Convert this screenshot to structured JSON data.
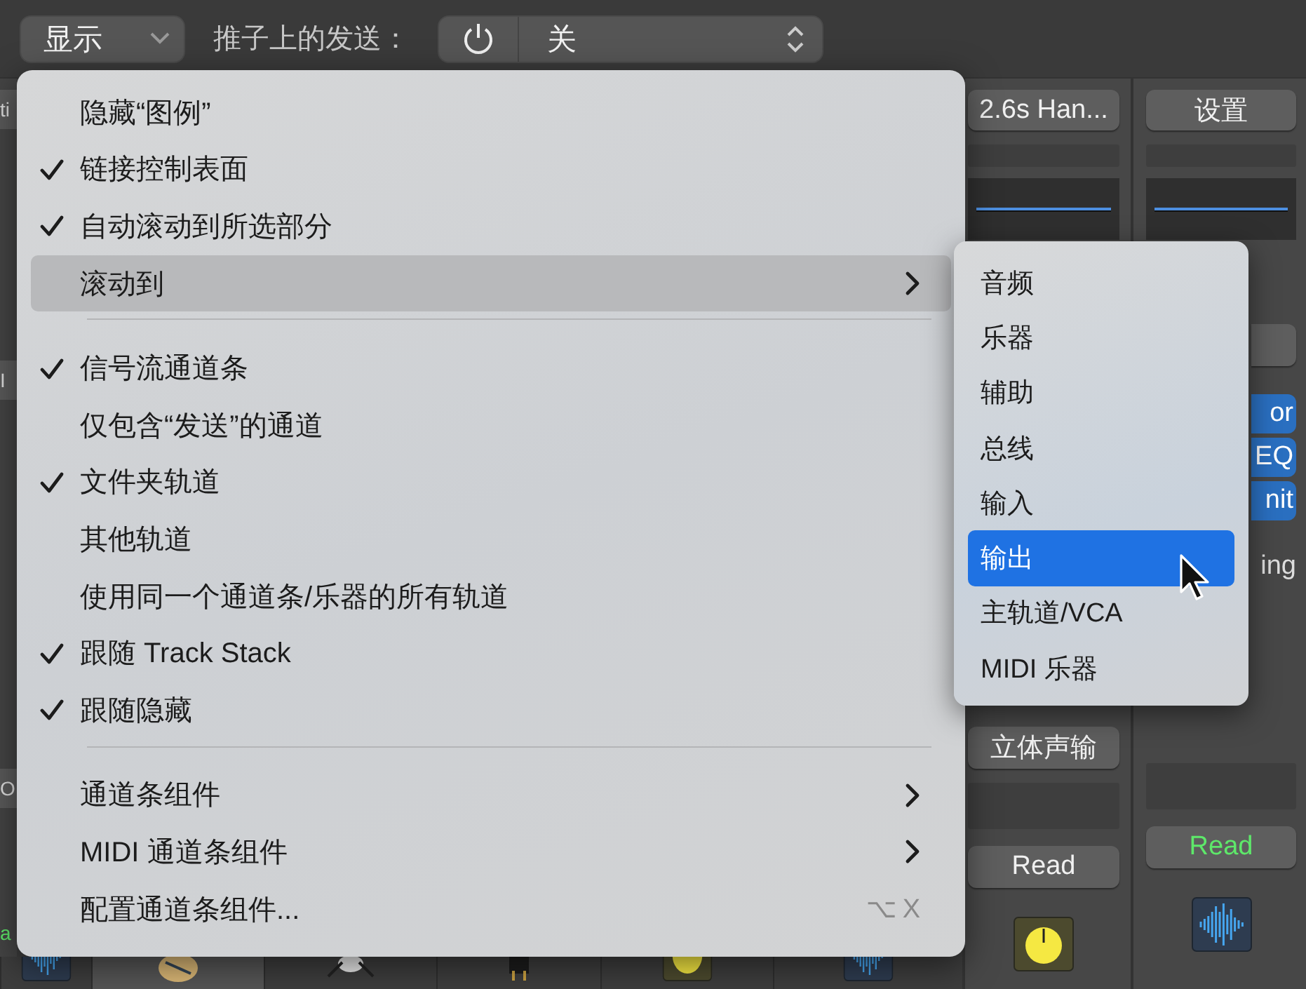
{
  "toolbar": {
    "view_menu": {
      "label": "显示"
    },
    "sends_label": "推子上的发送：",
    "sends_control": {
      "value": "关"
    }
  },
  "left_edge": [
    {
      "text": "ti",
      "kind": "button"
    },
    {
      "text": "I",
      "kind": "button"
    },
    {
      "text": "O",
      "kind": "button"
    },
    {
      "text": "a",
      "kind": "automation"
    }
  ],
  "strips": [
    {
      "top_button": "2.6s Han...",
      "output": "立体声输",
      "automation": {
        "label": "Read",
        "active": false
      }
    },
    {
      "top_button": "设置",
      "plugins": [
        "or",
        "EQ",
        "nit"
      ],
      "plugin_note": "ing",
      "automation": {
        "label": "Read",
        "active": true
      }
    }
  ],
  "menu": {
    "items": [
      {
        "kind": "item",
        "label": "隐藏“图例”",
        "checked": false,
        "selected": false
      },
      {
        "kind": "item",
        "label": "链接控制表面",
        "checked": true,
        "selected": false
      },
      {
        "kind": "item",
        "label": "自动滚动到所选部分",
        "checked": true,
        "selected": false
      },
      {
        "kind": "submenu",
        "label": "滚动到",
        "checked": false,
        "selected": true
      },
      {
        "kind": "separator"
      },
      {
        "kind": "item",
        "label": "信号流通道条",
        "checked": true,
        "selected": false
      },
      {
        "kind": "item",
        "label": "仅包含“发送”的通道",
        "checked": false,
        "selected": false
      },
      {
        "kind": "item",
        "label": "文件夹轨道",
        "checked": true,
        "selected": false
      },
      {
        "kind": "item",
        "label": "其他轨道",
        "checked": false,
        "selected": false
      },
      {
        "kind": "item",
        "label": "使用同一个通道条/乐器的所有轨道",
        "checked": false,
        "selected": false
      },
      {
        "kind": "item",
        "label": "跟随 Track Stack",
        "checked": true,
        "selected": false
      },
      {
        "kind": "item",
        "label": "跟随隐藏",
        "checked": true,
        "selected": false
      },
      {
        "kind": "separator"
      },
      {
        "kind": "submenu",
        "label": "通道条组件",
        "checked": false,
        "selected": false
      },
      {
        "kind": "submenu",
        "label": "MIDI 通道条组件",
        "checked": false,
        "selected": false
      },
      {
        "kind": "item",
        "label": "配置通道条组件...",
        "checked": false,
        "selected": false,
        "shortcut": "⌥X"
      }
    ]
  },
  "submenu": {
    "items": [
      {
        "label": "音频",
        "selected": false
      },
      {
        "label": "乐器",
        "selected": false
      },
      {
        "label": "辅助",
        "selected": false
      },
      {
        "label": "总线",
        "selected": false
      },
      {
        "label": "输入",
        "selected": false
      },
      {
        "label": "输出",
        "selected": true
      },
      {
        "label": "主轨道/VCA",
        "selected": false
      },
      {
        "label": "MIDI 乐器",
        "selected": false
      }
    ]
  }
}
